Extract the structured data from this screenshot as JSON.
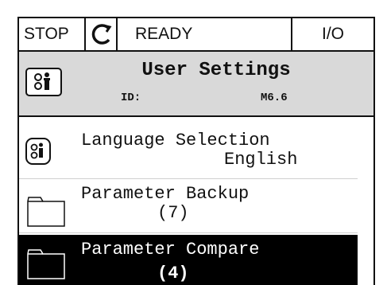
{
  "status_bar": {
    "stop_label": "STOP",
    "rotation_icon": "rotate-counterclockwise-icon",
    "ready_label": "READY",
    "io_label": "I/O"
  },
  "header": {
    "icon": "user-settings-icon",
    "title": "User Settings",
    "id_label": "ID:",
    "id_value": "M6.6",
    "background_color": "#d9d9d9"
  },
  "menu": {
    "items": [
      {
        "icon": "settings-selector-icon",
        "title": "Language Selection",
        "value": "English"
      },
      {
        "icon": "folder-icon",
        "title": "Parameter Backup",
        "value": "(7)"
      },
      {
        "icon": "folder-icon",
        "title": "Parameter Compare",
        "value": "(4)",
        "selected": true
      }
    ]
  },
  "colors": {
    "selected_background": "#000000",
    "selected_text": "#ffffff"
  }
}
